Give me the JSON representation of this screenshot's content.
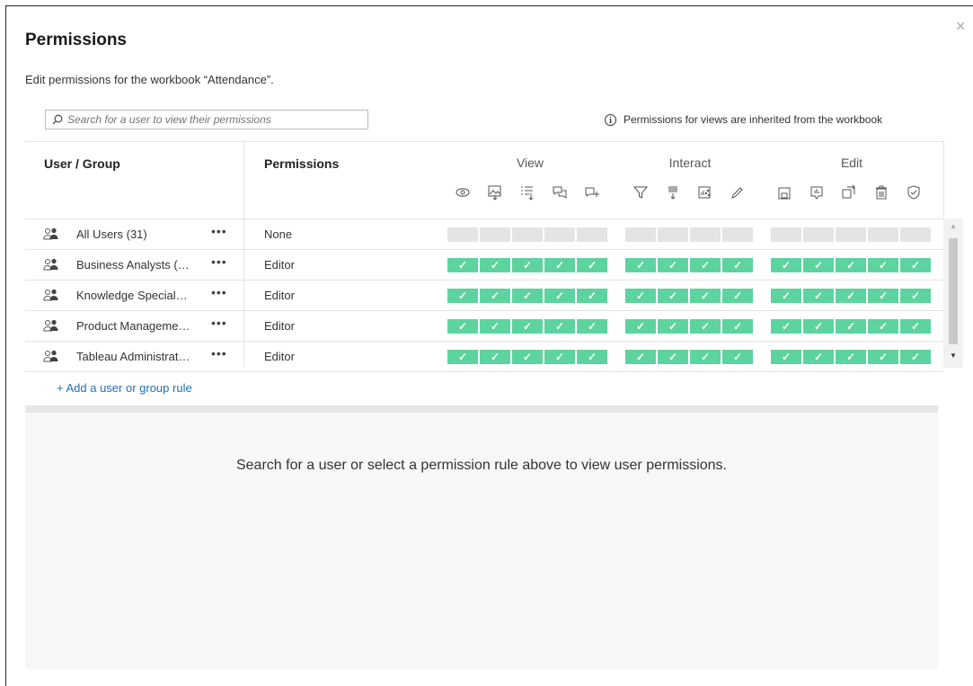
{
  "dialog": {
    "title": "Permissions",
    "subtitle": "Edit permissions for the workbook “Attendance”.",
    "close": "×"
  },
  "search": {
    "placeholder": "Search for a user to view their permissions"
  },
  "info_note": "Permissions for views are inherited from the workbook",
  "table": {
    "col_user": "User / Group",
    "col_permissions": "Permissions",
    "groups": [
      {
        "label": "View",
        "icons": [
          "view-eye-icon",
          "download-image-icon",
          "download-summary-data-icon",
          "view-comments-icon",
          "add-comment-icon"
        ]
      },
      {
        "label": "Interact",
        "icons": [
          "filter-icon",
          "download-full-data-icon",
          "share-customized-icon",
          "web-edit-icon"
        ]
      },
      {
        "label": "Edit",
        "icons": [
          "save-icon",
          "download-workbook-icon",
          "move-icon",
          "delete-icon",
          "set-permissions-icon"
        ]
      }
    ],
    "check": "✓",
    "more": "•••",
    "rows": [
      {
        "name": "All Users (31)",
        "permission": "None",
        "granted": false
      },
      {
        "name": "Business Analysts (…",
        "permission": "Editor",
        "granted": true
      },
      {
        "name": "Knowledge Special…",
        "permission": "Editor",
        "granted": true
      },
      {
        "name": "Product Manageme…",
        "permission": "Editor",
        "granted": true
      },
      {
        "name": "Tableau Administrat…",
        "permission": "Editor",
        "granted": true
      }
    ]
  },
  "add_rule": "+ Add a user or group rule",
  "lower_message": "Search for a user or select a permission rule above to view user permissions.",
  "colors": {
    "granted": "#5dd3a0",
    "unset": "#e4e4e4",
    "link": "#1f6fb8"
  }
}
